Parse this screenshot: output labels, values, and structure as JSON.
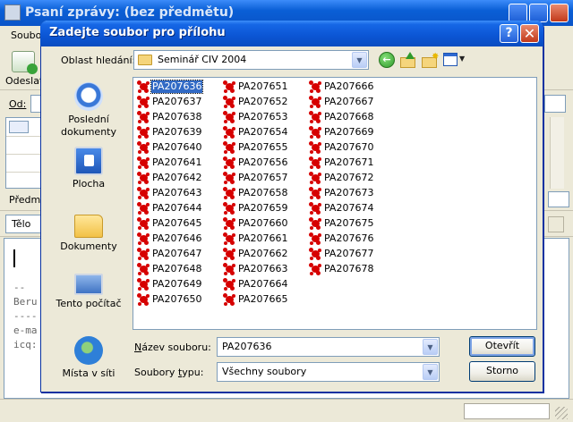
{
  "background_window": {
    "title": "Psaní zprávy: (bez předmětu)",
    "menu_first": "Soubor",
    "send_label": "Odeslat",
    "from_label": "Od:",
    "subject_label": "Předmět",
    "format_label": "Tělo",
    "signature": [
      "--",
      "Beru",
      "----",
      "e-ma",
      "icq:"
    ]
  },
  "dialog": {
    "title": "Zadejte soubor pro přílohu",
    "help_glyph": "?",
    "close_glyph": "✕",
    "look_in_label": "Oblast hledání:",
    "look_in_value": "Seminář CIV 2004",
    "places": [
      {
        "label": "Poslední dokumenty"
      },
      {
        "label": "Plocha"
      },
      {
        "label": "Dokumenty"
      },
      {
        "label": "Tento počítač"
      },
      {
        "label": "Místa v síti"
      }
    ],
    "files_col1": [
      "PA207636",
      "PA207637",
      "PA207638",
      "PA207639",
      "PA207640",
      "PA207641",
      "PA207642",
      "PA207643",
      "PA207644",
      "PA207645",
      "PA207646",
      "PA207647",
      "PA207648",
      "PA207649",
      "PA207650"
    ],
    "files_col2": [
      "PA207651",
      "PA207652",
      "PA207653",
      "PA207654",
      "PA207655",
      "PA207656",
      "PA207657",
      "PA207658",
      "PA207659",
      "PA207660",
      "PA207661",
      "PA207662",
      "PA207663",
      "PA207664",
      "PA207665"
    ],
    "files_col3": [
      "PA207666",
      "PA207667",
      "PA207668",
      "PA207669",
      "PA207670",
      "PA207671",
      "PA207672",
      "PA207673",
      "PA207674",
      "PA207675",
      "PA207676",
      "PA207677",
      "PA207678"
    ],
    "selected_file": "PA207636",
    "filename_label": "Název souboru:",
    "filename_value": "PA207636",
    "filetype_label": "Soubory typu:",
    "filetype_value": "Všechny soubory",
    "open_label": "Otevřít",
    "cancel_label": "Storno",
    "colors": {
      "selection": "#316ac5",
      "titlebar": "#0a55d4"
    }
  }
}
